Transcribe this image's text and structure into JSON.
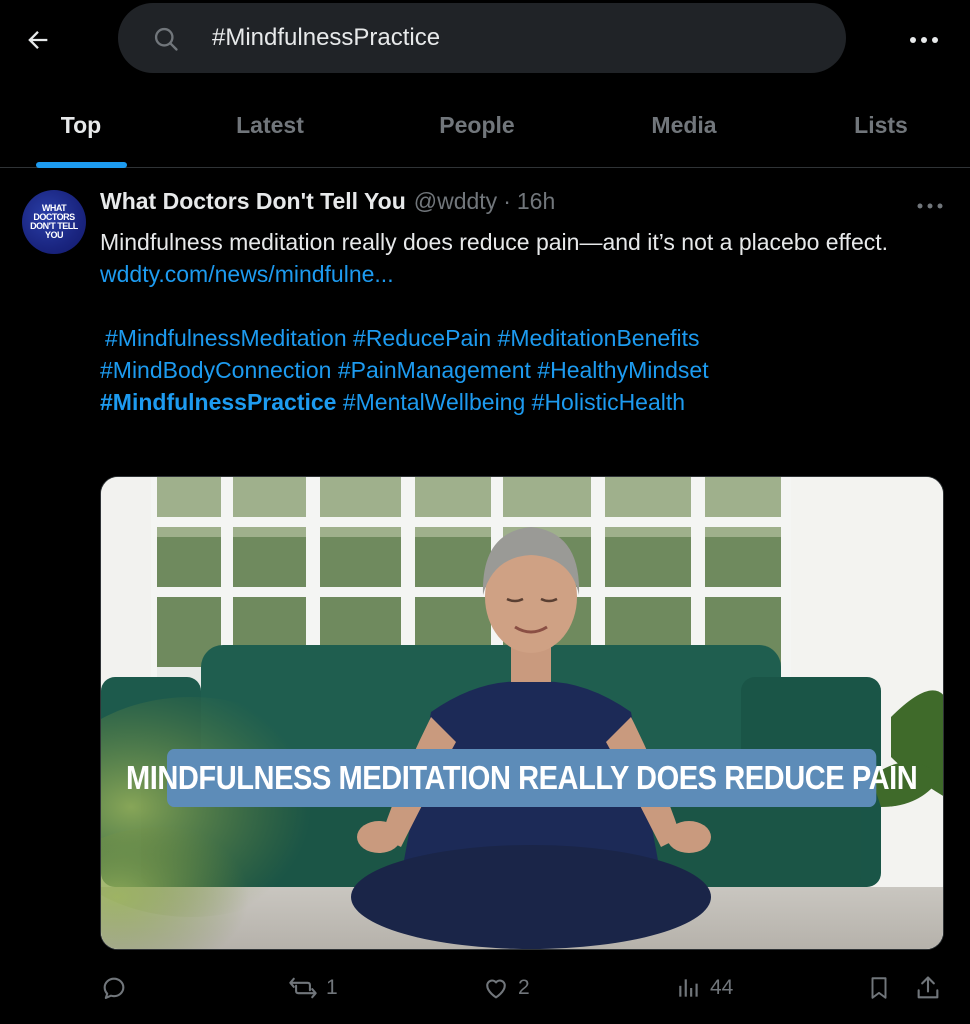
{
  "search": {
    "query": "#MindfulnessPractice"
  },
  "tabs": [
    {
      "label": "Top",
      "active": true
    },
    {
      "label": "Latest",
      "active": false
    },
    {
      "label": "People",
      "active": false
    },
    {
      "label": "Media",
      "active": false
    },
    {
      "label": "Lists",
      "active": false
    }
  ],
  "post": {
    "avatar_text_line1": "WHAT DOCTORS",
    "avatar_text_line2": "DON'T TELL YOU",
    "author_name": "What Doctors Don't Tell You",
    "author_handle": "@wddty",
    "separator": "·",
    "time": "16h",
    "text": "Mindfulness meditation really does reduce pain—and it’s not a placebo effect.",
    "link": "wddty.com/news/mindfulne...",
    "hashtags_line1": [
      "#MindfulnessMeditation",
      "#ReducePain",
      "#MeditationBenefits"
    ],
    "hashtags_line2": [
      "#MindBodyConnection",
      "#PainManagement",
      "#HealthyMindset"
    ],
    "hashtags_line3": [
      "#MindfulnessPractice",
      "#MentalWellbeing",
      "#HolisticHealth"
    ],
    "image_banner": "MINDFULNESS MEDITATION REALLY DOES REDUCE PAIN",
    "actions": {
      "reply_count": "",
      "repost_count": "1",
      "like_count": "2",
      "views_count": "44"
    }
  },
  "colors": {
    "background": "#000000",
    "accent": "#1d9bf0",
    "secondary_text": "#71767b",
    "banner": "#5d8cb8"
  },
  "icons": [
    "back-arrow-icon",
    "search-icon",
    "more-icon",
    "reply-icon",
    "repost-icon",
    "like-icon",
    "views-icon",
    "bookmark-icon",
    "share-icon"
  ]
}
